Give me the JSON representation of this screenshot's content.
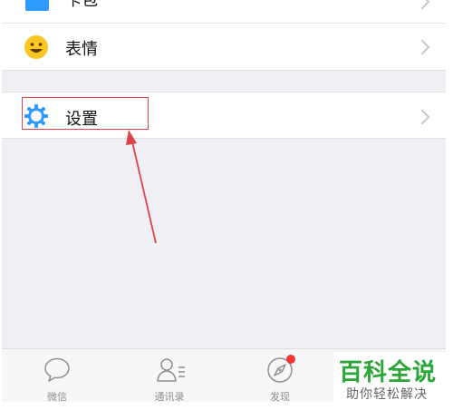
{
  "menu": {
    "cutoff_label": "卡包",
    "emoji_label": "表情",
    "settings_label": "设置"
  },
  "tabbar": {
    "chats": "微信",
    "contacts": "通讯录",
    "discover": "发现"
  },
  "watermark": {
    "title": "百科全说",
    "subtitle": "助你轻松解决"
  },
  "colors": {
    "accent_blue": "#2f9bff",
    "highlight_red": "#e0424a",
    "badge_red": "#f43530",
    "emoji_yellow": "#f9c623",
    "watermark_green": "#2aa537"
  }
}
